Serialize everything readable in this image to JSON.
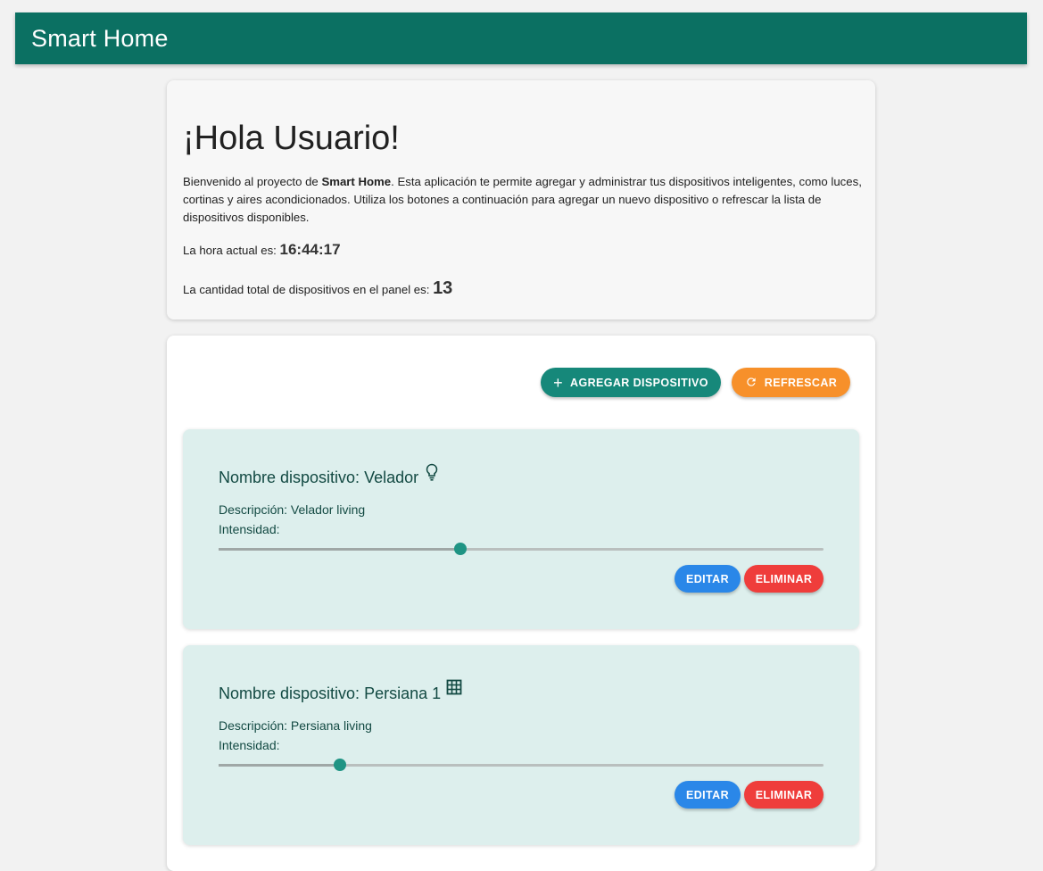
{
  "header": {
    "title": "Smart Home"
  },
  "welcome": {
    "greeting": "¡Hola Usuario!",
    "intro_prefix": "Bienvenido al proyecto de ",
    "intro_bold": "Smart Home",
    "intro_suffix": ". Esta aplicación te permite agregar y administrar tus dispositivos inteligentes, como luces, cortinas y aires acondicionados. Utiliza los botones a continuación para agregar un nuevo dispositivo o refrescar la lista de dispositivos disponibles.",
    "time_label": "La hora actual es: ",
    "time_value": "16:44:17",
    "count_label": "La cantidad total de dispositivos en el panel es: ",
    "count_value": "13"
  },
  "toolbar": {
    "add_label": "AGREGAR DISPOSITIVO",
    "add_icon": "plus-icon",
    "refresh_label": "REFRESCAR",
    "refresh_icon": "refresh-icon"
  },
  "devices": [
    {
      "title": "Nombre dispositivo: Velador",
      "icon": "lightbulb-icon",
      "description": "Descripción: Velador living",
      "intensity_label": "Intensidad:",
      "intensity": 0.4,
      "edit_label": "EDITAR",
      "delete_label": "ELIMINAR"
    },
    {
      "title": "Nombre dispositivo: Persiana 1",
      "icon": "window-grid-icon",
      "description": "Descripción: Persiana living",
      "intensity_label": "Intensidad:",
      "intensity": 0.2,
      "edit_label": "EDITAR",
      "delete_label": "ELIMINAR"
    }
  ],
  "colors": {
    "header": "#0b7062",
    "add_button": "#16887a",
    "refresh_button": "#f7902a",
    "edit_button": "#2a87e8",
    "delete_button": "#ef3d3b",
    "device_card": "#ddefed",
    "slider_thumb": "#1f9484"
  }
}
